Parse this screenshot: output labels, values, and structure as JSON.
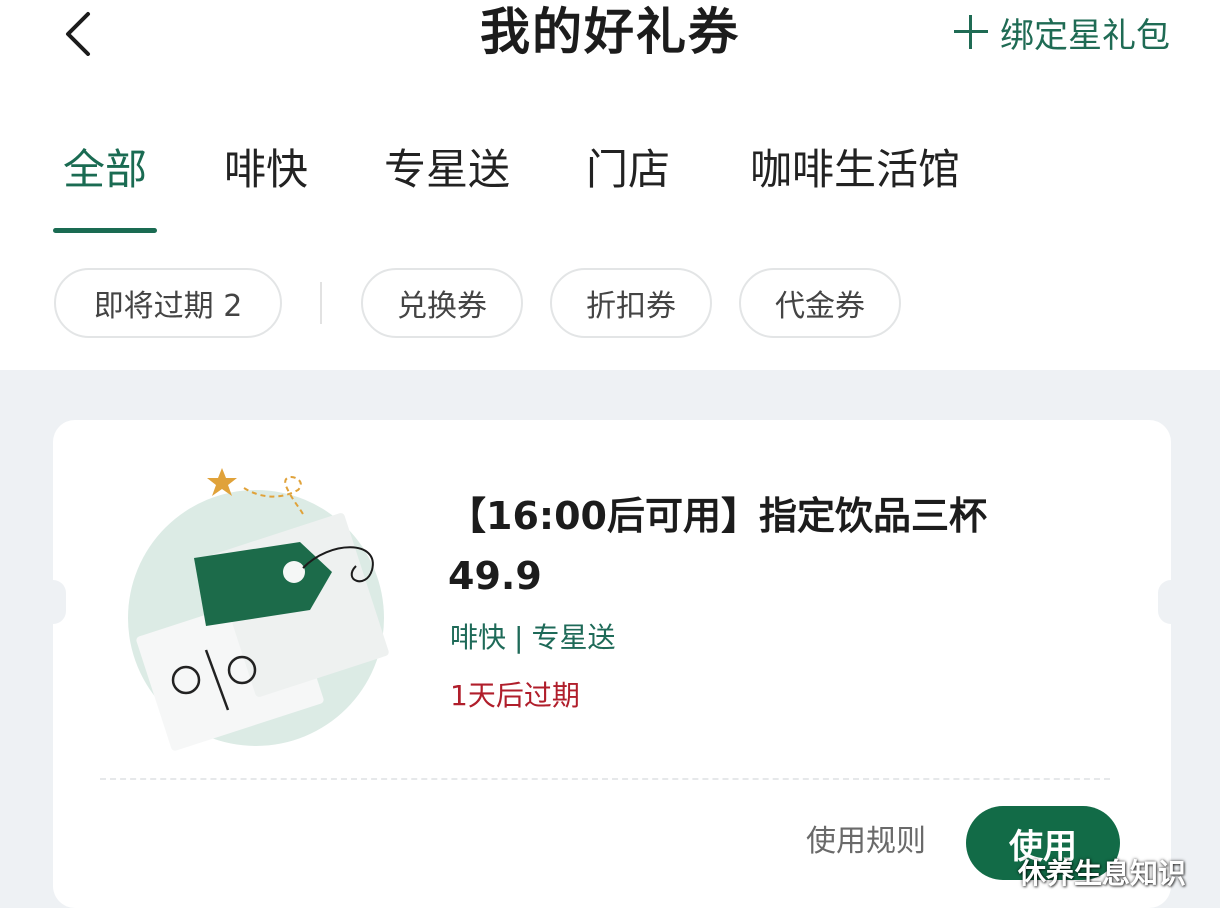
{
  "header": {
    "title": "我的好礼券",
    "bind_label": "绑定星礼包"
  },
  "tabs": [
    {
      "label": "全部",
      "active": true
    },
    {
      "label": "啡快",
      "active": false
    },
    {
      "label": "专星送",
      "active": false
    },
    {
      "label": "门店",
      "active": false
    },
    {
      "label": "咖啡生活馆",
      "active": false
    }
  ],
  "filters": [
    {
      "label": "即将过期 2"
    },
    {
      "label": "兑换券"
    },
    {
      "label": "折扣券"
    },
    {
      "label": "代金券"
    }
  ],
  "coupon": {
    "title_line1": "【16:00后可用】指定饮品三杯",
    "title_line2": "49.9",
    "channel_1": "啡快",
    "channel_sep": "|",
    "channel_2": "专星送",
    "expiry": "1天后过期",
    "rules_label": "使用规则",
    "use_label": "使用"
  },
  "watermark": "休养生息知识",
  "colors": {
    "accent_green": "#1a6b52",
    "button_green": "#126b47",
    "expiry_red": "#b01e2b"
  },
  "icons": [
    "back-arrow-icon",
    "plus-icon",
    "coupon-tag-illustration"
  ]
}
